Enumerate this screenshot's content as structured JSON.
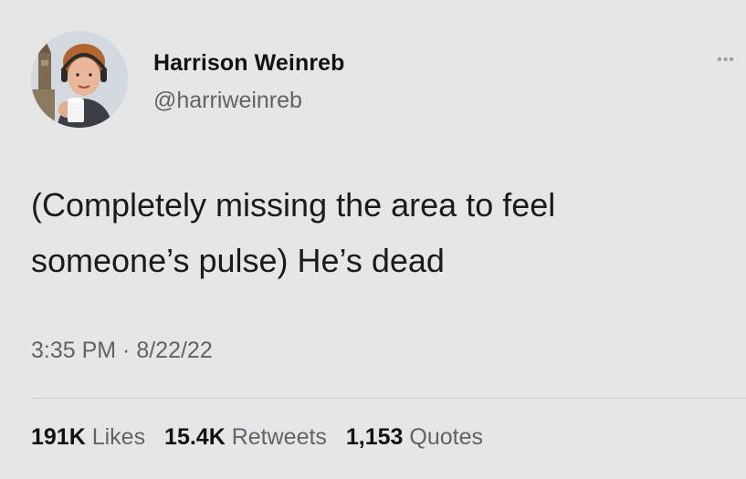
{
  "tweet": {
    "author": {
      "display_name": "Harrison Weinreb",
      "handle": "@harriweinreb",
      "avatar": "profile-photo"
    },
    "menu_icon": "more-icon",
    "text": "(Completely missing the area to feel\nsomeone’s pulse) He’s dead",
    "timestamp": "3:35 PM · 8/22/22",
    "stats": [
      {
        "value": "191K",
        "label": "Likes"
      },
      {
        "value": "15.4K",
        "label": "Retweets"
      },
      {
        "value": "1,153",
        "label": "Quotes"
      }
    ]
  }
}
